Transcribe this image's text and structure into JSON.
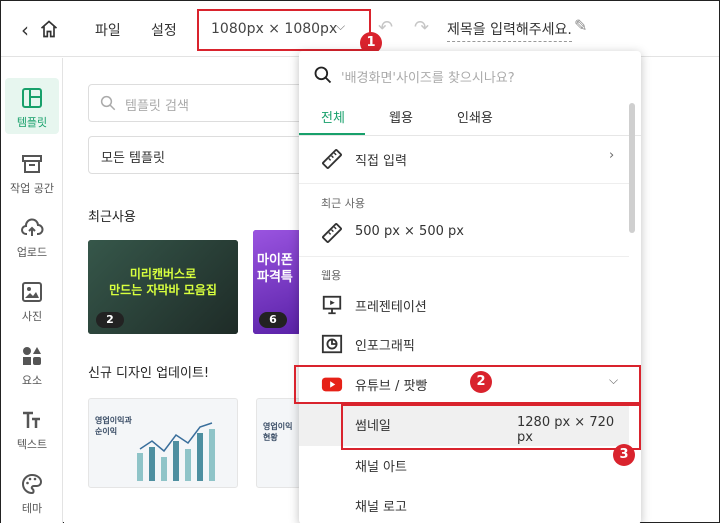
{
  "topbar": {
    "back_icon": "chevron-left-icon",
    "home_icon": "home-icon",
    "menu": [
      "파일",
      "설정"
    ],
    "size_selector": "1080px × 1080px",
    "document_title": "제목을 입력해주세요.",
    "undo_icon": "undo-icon",
    "redo_icon": "redo-icon",
    "edit_icon": "pencil-icon"
  },
  "sidebar": {
    "items": [
      {
        "label": "템플릿",
        "icon": "template-icon"
      },
      {
        "label": "작업 공간",
        "icon": "archive-icon"
      },
      {
        "label": "업로드",
        "icon": "upload-cloud-icon"
      },
      {
        "label": "사진",
        "icon": "image-icon"
      },
      {
        "label": "요소",
        "icon": "shapes-icon"
      },
      {
        "label": "텍스트",
        "icon": "text-icon"
      },
      {
        "label": "테마",
        "icon": "palette-icon"
      }
    ]
  },
  "panel": {
    "search_placeholder": "템플릿 검색",
    "template_filter": "모든 템플릿",
    "recent_title": "최근사용",
    "recent": [
      {
        "text": "미리캔버스로\n만드는 자막바 모음집",
        "count": "2"
      },
      {
        "text": "마이폰\n파격특",
        "count": "6"
      }
    ],
    "new_title": "신규 디자인 업데이트!",
    "new_items": [
      {
        "text": "영업이익과\n순이익"
      },
      {
        "text": "영업이익\n현황"
      }
    ]
  },
  "dropdown": {
    "search_placeholder": "'배경화면'사이즈를 찾으시나요?",
    "tabs": [
      "전체",
      "웹용",
      "인쇄용"
    ],
    "direct_input": "직접 입력",
    "recent_caption": "최근 사용",
    "recent_size": "500 px × 500 px",
    "web_caption": "웹용",
    "presentation": "프레젠테이션",
    "infographic": "인포그래픽",
    "youtube": "유튜브 / 팟빵",
    "sub_items": [
      {
        "label": "썸네일",
        "size": "1280 px × 720 px"
      },
      {
        "label": "채널 아트",
        "size": ""
      },
      {
        "label": "채널 로고",
        "size": ""
      }
    ]
  },
  "annotations": [
    "1",
    "2",
    "3"
  ],
  "colors": {
    "accent": "#18a06b",
    "highlight": "#d9232d",
    "youtube": "#e62117"
  }
}
